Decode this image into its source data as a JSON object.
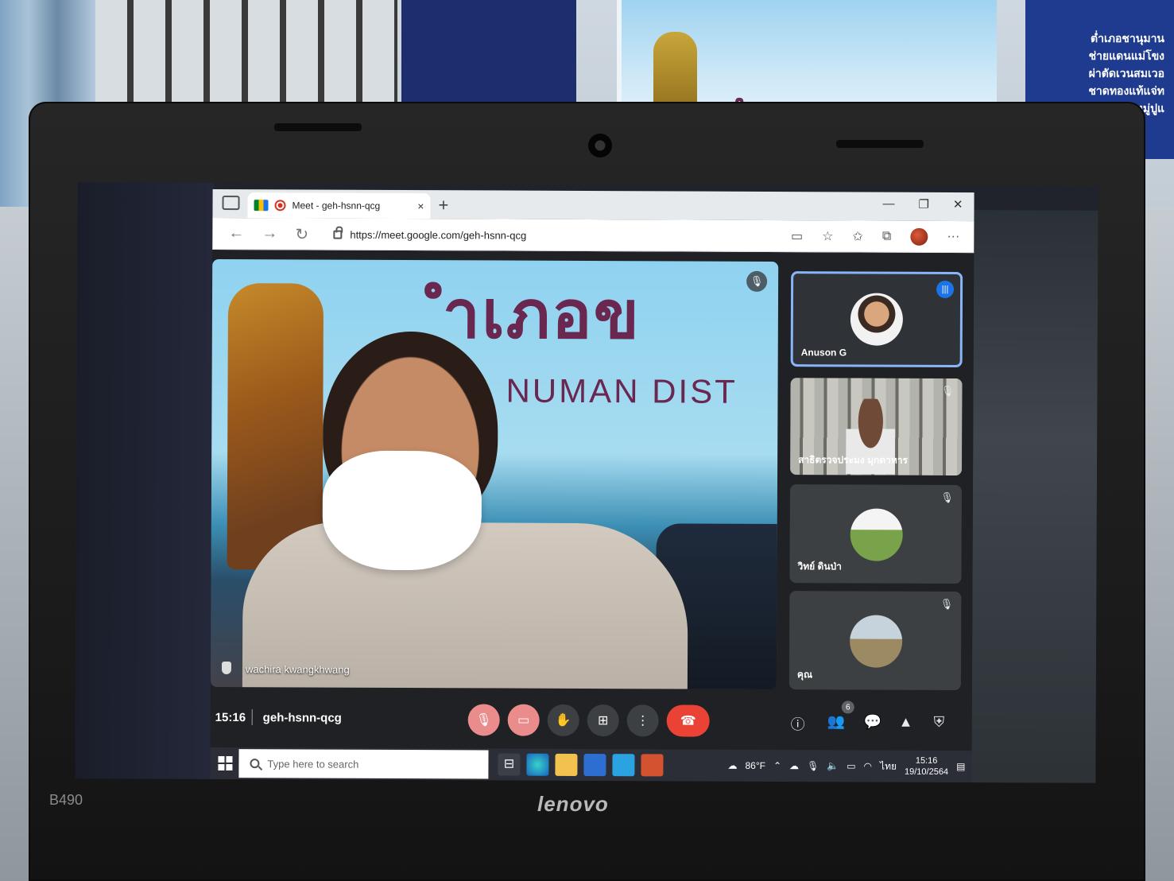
{
  "room": {
    "banner_title": "อำเภอชานุมาน",
    "sign_lines": [
      "ต่ำเภอชานุมาน",
      "ช่ายแดนแม่โขง",
      "ผ่าตัดเวนสมเวอ",
      "ชาดทองแท้แจ่ท",
      "แดนดินท่าสูง ชนหมู่ปูแ"
    ]
  },
  "laptop": {
    "model": "B490",
    "brand": "lenovo"
  },
  "browser": {
    "tab_title": "Meet - geh-hsnn-qcg",
    "tab_close": "×",
    "new_tab": "+",
    "url": "https://meet.google.com/geh-hsnn-qcg",
    "window_controls": [
      "—",
      "❐",
      "✕"
    ]
  },
  "meet": {
    "main_video": {
      "banner_text": "ำเภอข",
      "banner_sub": "NUMAN DIST",
      "participant_name": "wachira kwangkhwang"
    },
    "participants": [
      {
        "name": "Anuson G",
        "speaking": true
      },
      {
        "name": "สาธิตรวจประมง มุกดาหาร",
        "muted": true
      },
      {
        "name": "วิทย์ ดินป่า",
        "muted": true
      },
      {
        "name": "คุณ",
        "muted": true
      }
    ],
    "time": "15:16",
    "meeting_code": "geh-hsnn-qcg",
    "people_count": "6"
  },
  "taskbar": {
    "search_placeholder": "Type here to search",
    "temperature": "86°F",
    "language": "ไทย",
    "time": "15:16",
    "date": "19/10/2564"
  }
}
